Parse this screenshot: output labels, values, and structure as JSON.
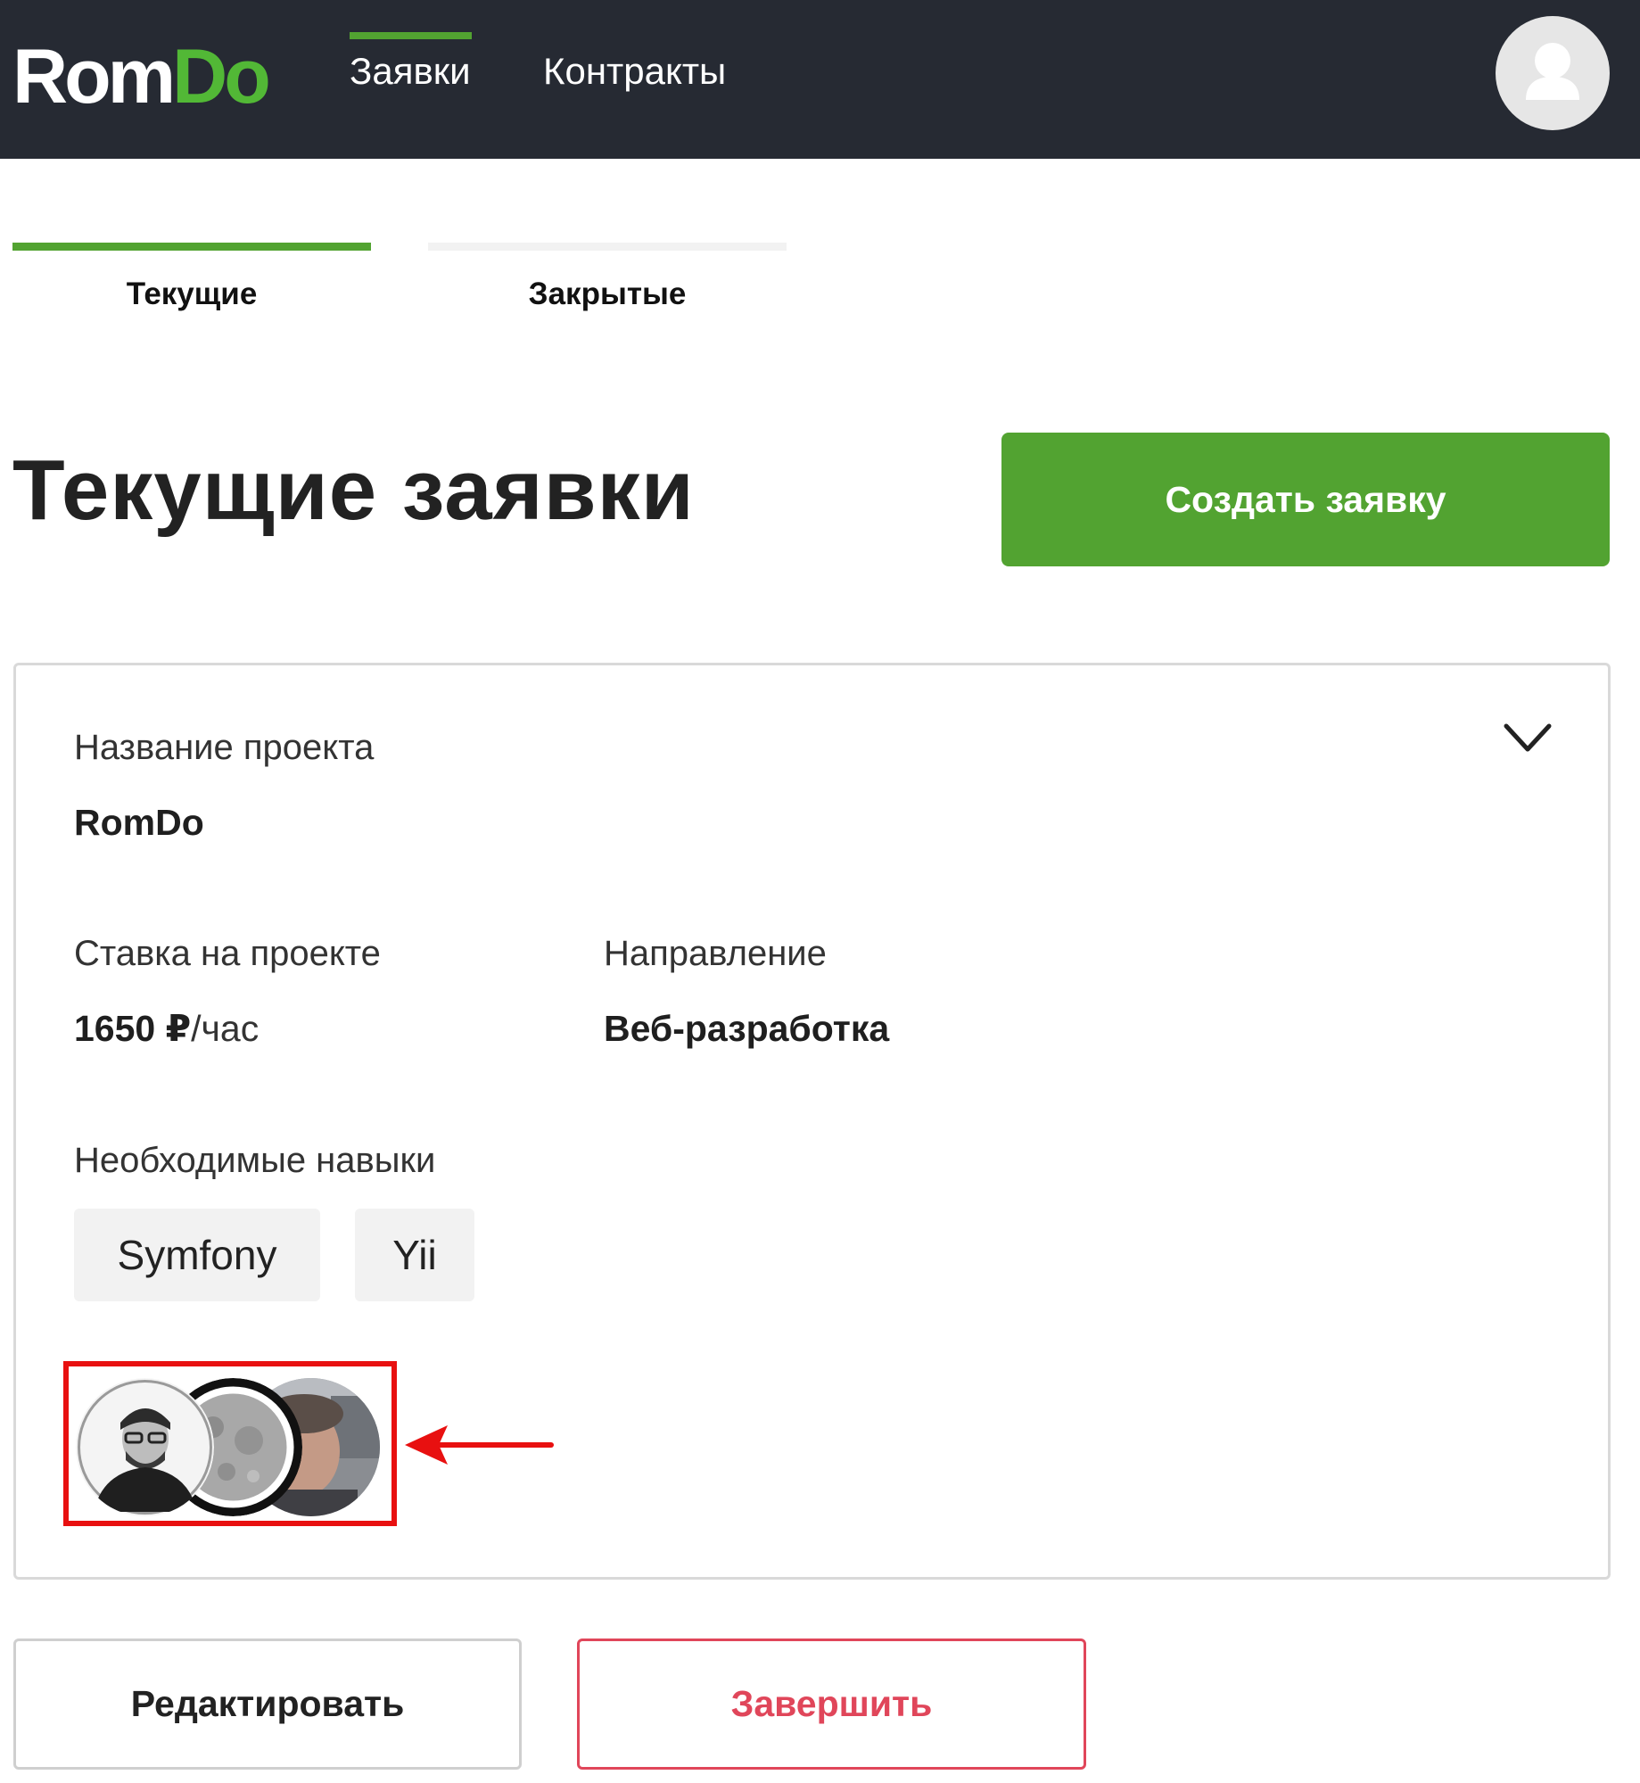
{
  "header": {
    "logo_part1": "Rom",
    "logo_part2": "Do",
    "nav": [
      {
        "label": "Заявки",
        "active": true
      },
      {
        "label": "Контракты",
        "active": false
      }
    ],
    "user_avatar_icon": "user-icon"
  },
  "tabs": [
    {
      "label": "Текущие",
      "active": true
    },
    {
      "label": "Закрытые",
      "active": false
    }
  ],
  "page": {
    "title": "Текущие заявки",
    "create_button": "Создать заявку"
  },
  "card": {
    "project_label": "Название проекта",
    "project_value": "RomDo",
    "rate_label": "Ставка на проекте",
    "rate_value": "1650 ₽",
    "rate_unit": "/час",
    "direction_label": "Направление",
    "direction_value": "Веб-разработка",
    "skills_label": "Необходимые навыки",
    "skills": [
      "Symfony",
      "Yii"
    ],
    "expand_icon": "chevron-down-icon"
  },
  "actions": {
    "edit": "Редактировать",
    "finish": "Завершить"
  },
  "colors": {
    "topbar": "#262a33",
    "accent_green": "#52a331",
    "danger": "#e0465a",
    "highlight_red": "#e81010"
  }
}
